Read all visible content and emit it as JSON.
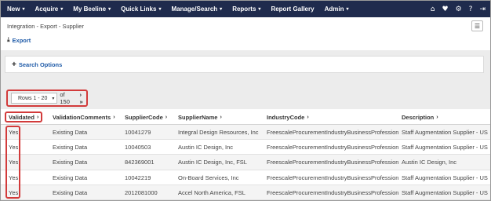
{
  "nav": {
    "items": [
      {
        "label": "New",
        "caret": "▾"
      },
      {
        "label": "Acquire",
        "caret": "▾"
      },
      {
        "label": "My Beeline",
        "caret": "▾"
      },
      {
        "label": "Quick Links",
        "caret": "▾"
      },
      {
        "label": "Manage/Search",
        "caret": "▾"
      },
      {
        "label": "Reports",
        "caret": "▾"
      },
      {
        "label": "Report Gallery",
        "caret": ""
      },
      {
        "label": "Admin",
        "caret": "▾"
      }
    ],
    "icons": {
      "home": "⌂",
      "favorites": "♥",
      "settings": "⚙",
      "help": "?",
      "logout": "⇥"
    }
  },
  "breadcrumb": "Integration - Export - Supplier",
  "export_label": "Export",
  "menu_icon": "☰",
  "search_options_label": "Search Options",
  "pager": {
    "selected": "Rows 1 - 20",
    "of_label": "of 150",
    "next_icons": "› »"
  },
  "table": {
    "columns": [
      "Validated",
      "ValidationComments",
      "SupplierCode",
      "SupplierName",
      "IndustryCode",
      "Description"
    ],
    "sort_icon": "›",
    "rows": [
      [
        "Yes",
        "Existing Data",
        "10041279",
        "Integral Design Resources, Inc",
        "FreescaleProcurementIndustryBusinessProfessional",
        "Staff Augmentation Supplier - US"
      ],
      [
        "Yes",
        "Existing Data",
        "10040503",
        "Austin IC Design, Inc",
        "FreescaleProcurementIndustryBusinessProfessional",
        "Staff Augmentation Supplier - US"
      ],
      [
        "Yes",
        "Existing Data",
        "842369001",
        "Austin IC Design, Inc, FSL",
        "FreescaleProcurementIndustryBusinessProfessional",
        "Austin IC Design, Inc"
      ],
      [
        "Yes",
        "Existing Data",
        "10042219",
        "On-Board Services, Inc",
        "FreescaleProcurementIndustryBusinessProfessional",
        "Staff Augmentation Supplier - US"
      ],
      [
        "Yes",
        "Existing Data",
        "2012081000",
        "Accel North America, FSL",
        "FreescaleProcurementIndustryBusinessProfessional",
        "Staff Augmentation Supplier - US"
      ]
    ]
  }
}
